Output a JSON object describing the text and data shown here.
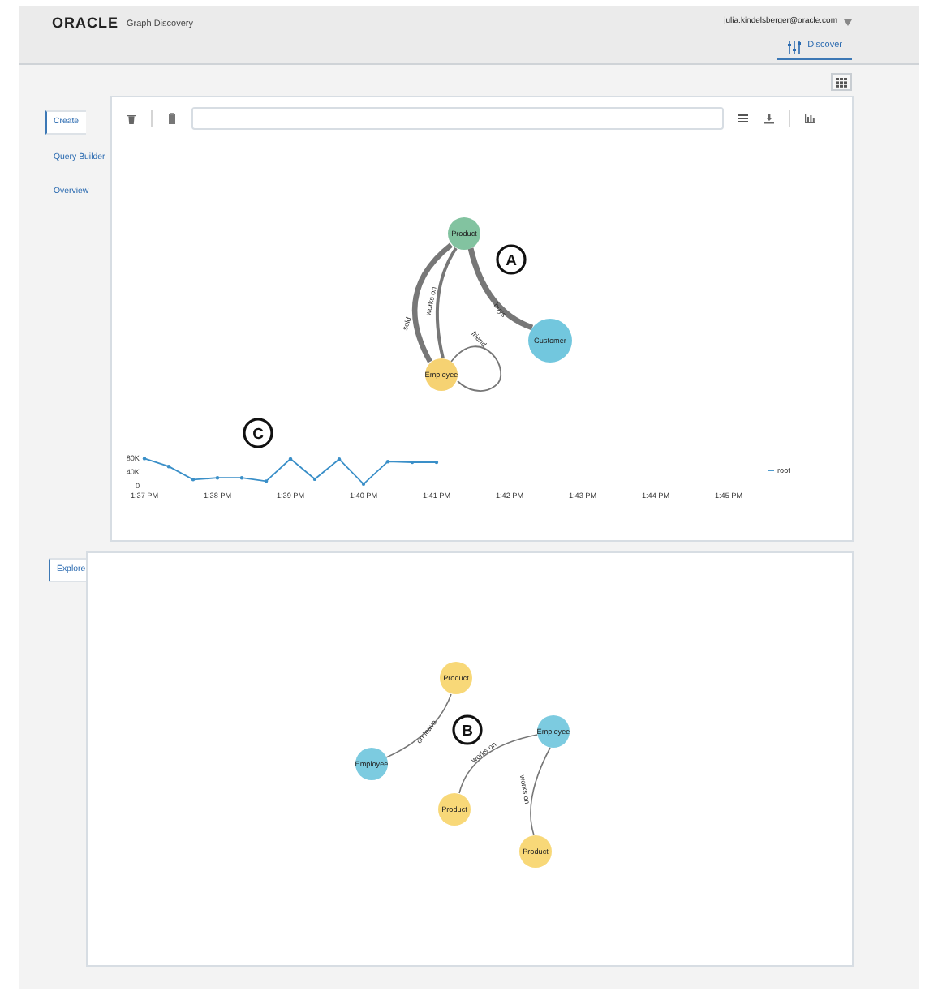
{
  "header": {
    "logo": "ORACLE",
    "app_title": "Graph Discovery",
    "user": "julia.kindelsberger@oracle.com",
    "nav_tabs": [
      {
        "label": "Discover",
        "selected": true
      }
    ]
  },
  "create_section": {
    "tabs": [
      {
        "label": "Create",
        "selected": true
      },
      {
        "label": "Query Builder",
        "selected": false
      },
      {
        "label": "Overview",
        "selected": false
      }
    ],
    "graph": {
      "nodes": [
        {
          "label": "Product",
          "color": "#82c3a0"
        },
        {
          "label": "Customer",
          "color": "#72c7de"
        },
        {
          "label": "Employee",
          "color": "#f6d272"
        }
      ],
      "edges": [
        {
          "label": "sold"
        },
        {
          "label": "works on"
        },
        {
          "label": "buys"
        },
        {
          "label": "friend"
        }
      ]
    },
    "callout": "A",
    "chart_callout": "C",
    "chart_data": {
      "type": "line",
      "categories": [
        "1:37 PM",
        null,
        null,
        "1:38 PM",
        null,
        null,
        "1:39 PM",
        null,
        null,
        "1:40 PM",
        null,
        null,
        "1:41 PM",
        null,
        null,
        "1:42 PM",
        null,
        null,
        "1:43 PM",
        null,
        null,
        "1:44 PM",
        null,
        null,
        "1:45 PM"
      ],
      "ylim": [
        0,
        80000
      ],
      "yticks": [
        {
          "value": 0,
          "label": "0"
        },
        {
          "value": 40000,
          "label": "40K"
        },
        {
          "value": 80000,
          "label": "80K"
        }
      ],
      "series": [
        {
          "name": "root",
          "color": "#3a8fc8",
          "values": [
            80000,
            57000,
            19000,
            24000,
            24000,
            14000,
            79000,
            20000,
            78000,
            6000,
            71000,
            69000,
            69000,
            null,
            null,
            null,
            null,
            null,
            null,
            null,
            null,
            null,
            null,
            null,
            null
          ]
        }
      ]
    }
  },
  "explore_section": {
    "tabs": [
      {
        "label": "Explore",
        "selected": true
      }
    ],
    "graph": {
      "nodes": [
        {
          "label": "Product",
          "color": "#f8d878"
        },
        {
          "label": "Employee",
          "color": "#7ccbe0"
        },
        {
          "label": "Employee",
          "color": "#7ccbe0"
        },
        {
          "label": "Product",
          "color": "#f8d878"
        },
        {
          "label": "Product",
          "color": "#f8d878"
        }
      ],
      "edges": [
        {
          "label": "on leave"
        },
        {
          "label": "works on"
        },
        {
          "label": "works on"
        }
      ]
    },
    "callout": "B"
  }
}
